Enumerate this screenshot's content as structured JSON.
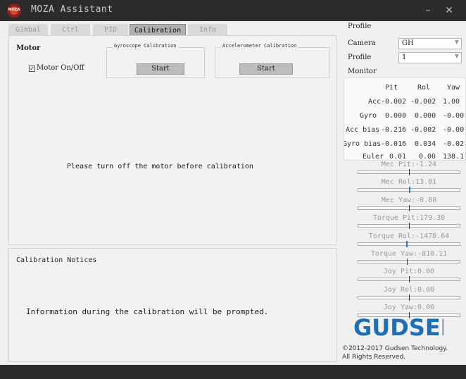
{
  "window": {
    "title": "MOZA Assistant",
    "logo_text": "MOZA",
    "minimize_glyph": "–",
    "close_glyph": "✕"
  },
  "tabs": [
    {
      "label": "Gimbal",
      "active": false
    },
    {
      "label": "Ctrl",
      "active": false
    },
    {
      "label": "PID",
      "active": false
    },
    {
      "label": "Calibration",
      "active": true
    },
    {
      "label": "Info",
      "active": false
    }
  ],
  "motor": {
    "title": "Motor",
    "checkbox_label": "Motor On/Off",
    "checked": true
  },
  "gyro_calibration": {
    "title": "Gyroscope Calibration",
    "button": "Start"
  },
  "accel_calibration": {
    "title": "Accelerometer Calibration",
    "button": "Start"
  },
  "main_message": "Please turn off the motor before calibration",
  "notices": {
    "title": "Calibration Notices",
    "message": "Information during the calibration will be prompted."
  },
  "profile": {
    "section_label": "Profile",
    "camera_label": "Camera",
    "camera_value": "GH",
    "profile_label": "Profile",
    "profile_value": "1"
  },
  "monitor": {
    "label": "Monitor",
    "headers": [
      "Pit",
      "Rol",
      "Yaw"
    ],
    "rows": [
      {
        "name": "Acc",
        "values": [
          "-0.002",
          "-0.002",
          "1.00"
        ]
      },
      {
        "name": "Gyro",
        "values": [
          "0.000",
          "0.000",
          "-0.00"
        ]
      },
      {
        "name": "Acc bias",
        "values": [
          "-0.216",
          "-0.002",
          "-0.00"
        ]
      },
      {
        "name": "Gyro bias",
        "values": [
          "-0.016",
          "0.034",
          "-0.02"
        ]
      },
      {
        "name": "Euler",
        "values": [
          "0.01",
          "0.00",
          "138.1"
        ]
      }
    ]
  },
  "bars": [
    {
      "label": "Mec Pit:-1.24",
      "level": 0.5,
      "blue": false
    },
    {
      "label": "Mec Rol:13.81",
      "level": 0.5,
      "blue": true
    },
    {
      "label": "Mec Yaw:-0.80",
      "level": 0.5,
      "blue": false
    },
    {
      "label": "Torque Pit:179.30",
      "level": 0.5,
      "blue": false
    },
    {
      "label": "Torque Rol:-1478.64",
      "level": 0.47,
      "blue": true
    },
    {
      "label": "Torque Yaw:-810.11",
      "level": 0.48,
      "blue": false
    },
    {
      "label": "Joy Pit:0.00",
      "level": 0.5,
      "blue": false
    },
    {
      "label": "Joy Rol:0.00",
      "level": 0.5,
      "blue": false
    },
    {
      "label": "Joy Yaw:0.00",
      "level": 0.5,
      "blue": false
    }
  ],
  "brand": {
    "logo_text": "GUDSEN",
    "copyright_line1": "©2012-2017 Gudsen Technology.",
    "copyright_line2": "All Rights Reserved.",
    "logo_color": "#1f6fb5",
    "logo_accent": "#d23a2a"
  }
}
